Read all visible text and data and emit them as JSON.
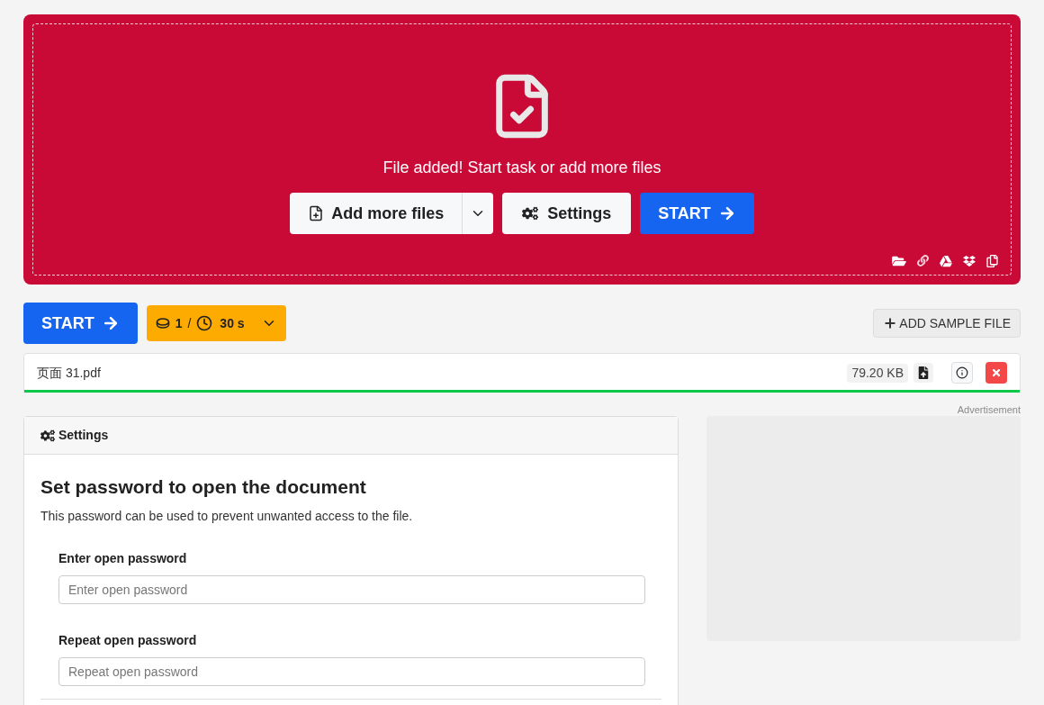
{
  "dropzone": {
    "message": "File added! Start task or add more files",
    "add_button": "Add more files",
    "settings_button": "Settings",
    "start_button": "START"
  },
  "toolbar": {
    "start_button": "START",
    "credits": "1",
    "separator": "/",
    "time": "30 s",
    "sample_button": "ADD SAMPLE FILE"
  },
  "file": {
    "name": "页面 31.pdf",
    "size": "79.20 KB",
    "level": 1
  },
  "ad": {
    "label": "Advertisement"
  },
  "settings": {
    "header": "Settings",
    "title": "Set password to open the document",
    "description": "This password can be used to prevent unwanted access to the file.",
    "fields": [
      {
        "label": "Enter open password",
        "placeholder": "Enter open password"
      },
      {
        "label": "Repeat open password",
        "placeholder": "Repeat open password"
      }
    ]
  }
}
